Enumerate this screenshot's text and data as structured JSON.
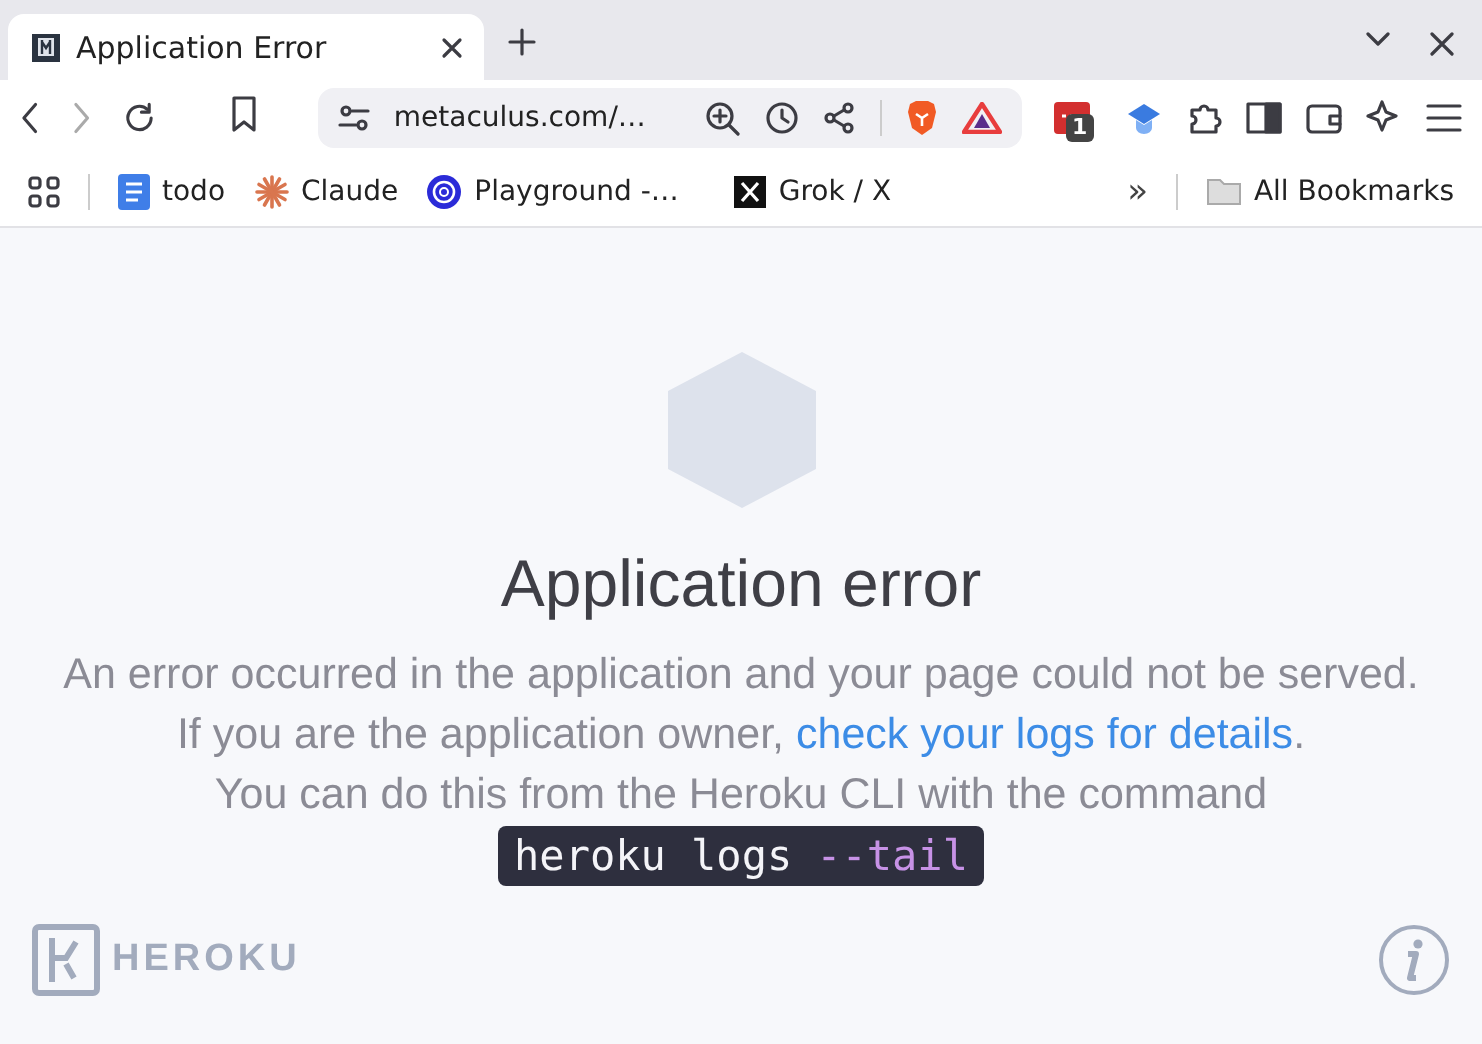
{
  "tab": {
    "title": "Application Error",
    "selected": true
  },
  "address_bar": {
    "url": "metaculus.com/…"
  },
  "extension_badge": "1",
  "bookmarks": [
    {
      "label": "todo",
      "kind": "doc"
    },
    {
      "label": "Claude",
      "kind": "claude"
    },
    {
      "label": "Playground -…",
      "kind": "openai"
    },
    {
      "label": "Grok / X",
      "kind": "x"
    }
  ],
  "overflow": "»",
  "all_bookmarks": "All Bookmarks",
  "error": {
    "title": "Application error",
    "message": "An error occurred in the application and your page could not be served. If you are the application owner, ",
    "link": "check your logs for details",
    "after_link": ".",
    "hint": "You can do this from the Heroku CLI with the command",
    "command": "heroku logs",
    "flag": "--tail"
  },
  "brand": "HEROKU"
}
